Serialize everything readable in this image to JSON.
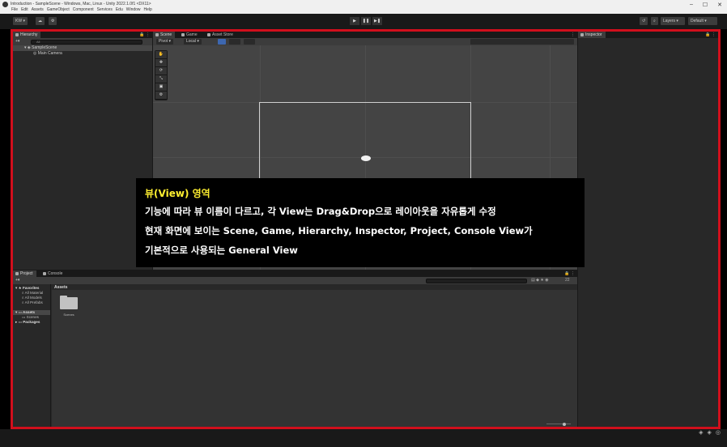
{
  "window": {
    "title": "Introduction - SampleScene - Windows, Mac, Linux - Unity 2022.1.0f1 <DX11>",
    "menu": [
      "File",
      "Edit",
      "Assets",
      "GameObject",
      "Component",
      "Services",
      "Edu",
      "Window",
      "Help"
    ],
    "controls": [
      "–",
      "☐",
      "✕"
    ]
  },
  "toolbar": {
    "account": "KW",
    "cloud": "☁",
    "settings": "⚙",
    "play": [
      "▶",
      "❚❚",
      "▶❚"
    ],
    "history": "↺",
    "search": "⌕",
    "layers": "Layers",
    "layout": "Default"
  },
  "hierarchy": {
    "tab": "Hierarchy",
    "add": "+▾",
    "search_placeholder": "All",
    "scene": "SampleScene",
    "items": [
      "Main Camera"
    ]
  },
  "scene_view": {
    "tabs": [
      "Scene",
      "Game",
      "Asset Store"
    ],
    "pivot": "Pivot",
    "space": "Local",
    "tools": [
      "✋",
      "✥",
      "⟳",
      "⤡",
      "▣",
      "⚙"
    ]
  },
  "inspector": {
    "tab": "Inspector"
  },
  "overlay": {
    "heading": "뷰(View) 영역",
    "lines": [
      "기능에 따라 뷰 이름이 다르고, 각 View는 Drag&Drop으로 레이아웃을 자유롭게 수정",
      "현재 화면에 보이는 Scene, Game, Hierarchy, Inspector, Project, Console View가",
      "기본적으로 사용되는 General View"
    ]
  },
  "project": {
    "tabs": [
      "Project",
      "Console"
    ],
    "add": "+▾",
    "count": "22",
    "tree": {
      "favorites": "Favorites",
      "favorite_items": [
        "All Material",
        "All Models",
        "All Prefabs"
      ],
      "assets": "Assets",
      "asset_items": [
        "Scenes"
      ],
      "packages": "Packages"
    },
    "breadcrumb": "Assets",
    "files": [
      {
        "name": "Scenes"
      }
    ]
  }
}
